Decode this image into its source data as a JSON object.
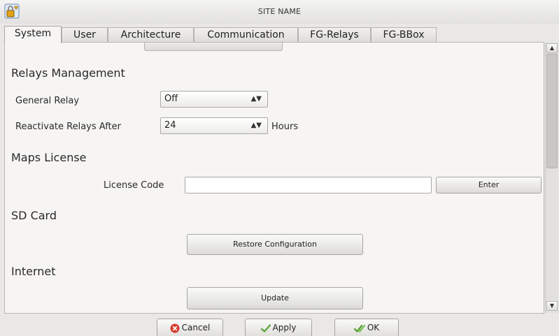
{
  "window": {
    "title": "SITE NAME",
    "icon": "lock-key-icon"
  },
  "tabs": [
    {
      "label": "System",
      "active": true
    },
    {
      "label": "User",
      "active": false
    },
    {
      "label": "Architecture",
      "active": false
    },
    {
      "label": "Communication",
      "active": false
    },
    {
      "label": "FG-Relays",
      "active": false
    },
    {
      "label": "FG-BBox",
      "active": false
    }
  ],
  "relays": {
    "heading": "Relays Management",
    "general_relay": {
      "label": "General Relay",
      "value": "Off"
    },
    "reactivate": {
      "label": "Reactivate Relays After",
      "value": "24",
      "unit": "Hours"
    }
  },
  "maps": {
    "heading": "Maps License",
    "license_label": "License Code",
    "license_value": "",
    "enter_label": "Enter"
  },
  "sdcard": {
    "heading": "SD Card",
    "restore_label": "Restore Configuration"
  },
  "internet": {
    "heading": "Internet",
    "update_label": "Update"
  },
  "footer": {
    "cancel_label": "Cancel",
    "apply_label": "Apply",
    "ok_label": "OK"
  },
  "colors": {
    "cancel_icon": "#d63a2f",
    "apply_icon": "#5aa83a",
    "ok_icon": "#4b9a2e"
  }
}
